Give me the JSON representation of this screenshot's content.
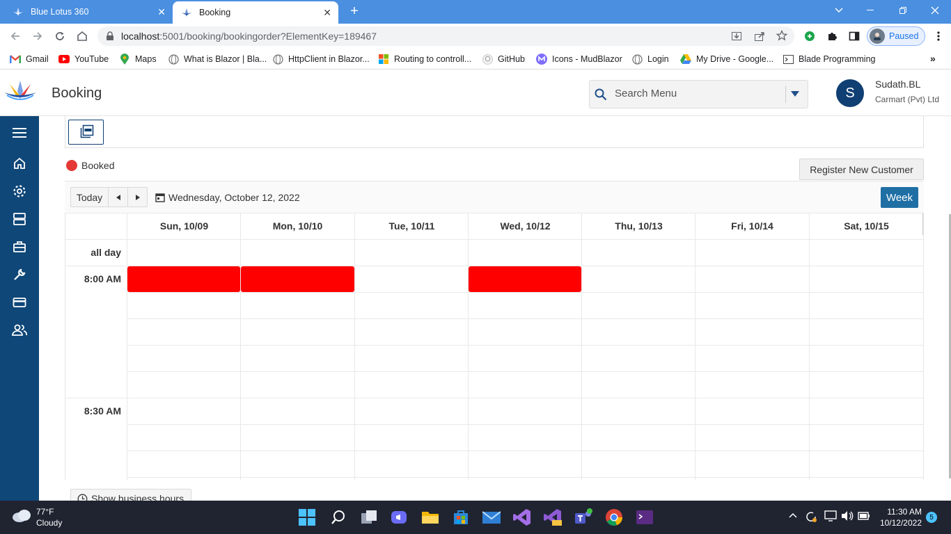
{
  "browser": {
    "tabs": [
      {
        "title": "Blue Lotus 360",
        "active": false
      },
      {
        "title": "Booking",
        "active": true
      }
    ],
    "url_host": "localhost",
    "url_path": ":5001/booking/bookingorder?ElementKey=189467",
    "profile_status": "Paused",
    "bookmarks": [
      {
        "label": "Gmail",
        "icon": "gmail-icon"
      },
      {
        "label": "YouTube",
        "icon": "youtube-icon"
      },
      {
        "label": "Maps",
        "icon": "maps-icon"
      },
      {
        "label": "What is Blazor | Bla...",
        "icon": "globe-icon"
      },
      {
        "label": "HttpClient in Blazor...",
        "icon": "globe-icon"
      },
      {
        "label": "Routing to controll...",
        "icon": "microsoft-icon"
      },
      {
        "label": "GitHub",
        "icon": "github-icon"
      },
      {
        "label": "Icons - MudBlazor",
        "icon": "mudblazor-icon"
      },
      {
        "label": "Login",
        "icon": "globe-icon"
      },
      {
        "label": "My Drive - Google...",
        "icon": "drive-icon"
      },
      {
        "label": "Blade Programming",
        "icon": "terminal-icon"
      }
    ]
  },
  "app": {
    "page_title": "Booking",
    "search_placeholder": "Search Menu",
    "user_initial": "S",
    "user_name": "Sudath.BL",
    "company": "Carmart (Pvt) Ltd"
  },
  "booking": {
    "legend_label": "Booked",
    "register_button": "Register New Customer",
    "today_button": "Today",
    "current_date": "Wednesday, October 12, 2022",
    "view_button": "Week",
    "all_day_label": "all day",
    "days": [
      "Sun, 10/09",
      "Mon, 10/10",
      "Tue, 10/11",
      "Wed, 10/12",
      "Thu, 10/13",
      "Fri, 10/14",
      "Sat, 10/15"
    ],
    "time_slots": [
      "8:00 AM",
      "8:30 AM"
    ],
    "events": [
      {
        "day_index": 0,
        "slot": "8:00 AM",
        "status": "Booked"
      },
      {
        "day_index": 1,
        "slot": "8:00 AM",
        "status": "Booked"
      },
      {
        "day_index": 3,
        "slot": "8:00 AM",
        "status": "Booked"
      }
    ],
    "event_color": "#ff0000",
    "business_hours_button": "Show business hours"
  },
  "taskbar": {
    "weather_temp": "77°F",
    "weather_desc": "Cloudy",
    "time": "11:30 AM",
    "date": "10/12/2022",
    "notification_count": "5"
  },
  "colors": {
    "sidebar": "#0f4778",
    "accent": "#1f6fa5",
    "chrome_tabbar": "#4a8fe0"
  }
}
